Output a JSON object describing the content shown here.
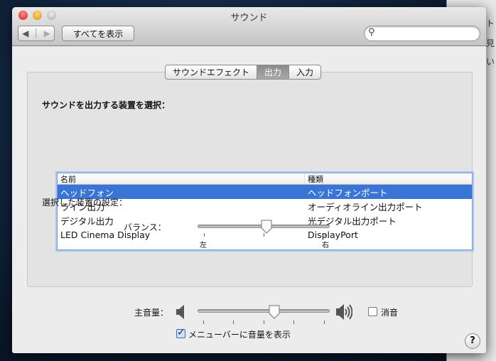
{
  "window": {
    "title": "サウンド",
    "show_all": "すべてを表示",
    "search_placeholder": ""
  },
  "tabs": [
    {
      "label": "サウンドエフェクト"
    },
    {
      "label": "出力",
      "selected": true
    },
    {
      "label": "入力"
    }
  ],
  "output": {
    "heading": "サウンドを出力する装置を選択：",
    "columns": [
      "名前",
      "種類"
    ],
    "rows": [
      {
        "name": "ヘッドフォン",
        "type": "ヘッドフォンポート",
        "selected": true
      },
      {
        "name": "ライン出力",
        "type": "オーディオライン出力ポート"
      },
      {
        "name": "デジタル出力",
        "type": "光デジタル出力ポート"
      },
      {
        "name": "LED Cinema Display",
        "type": "DisplayPort"
      }
    ],
    "settings_label": "選択した装置の設定：",
    "balance_label": "バランス：",
    "balance_left": "左",
    "balance_right": "右",
    "balance_value": 0.5,
    "help": "?"
  },
  "volume": {
    "label": "主音量：",
    "value": 0.56,
    "mute_label": "消音",
    "muted": false,
    "show_in_menubar_label": "メニューバーに音量を表示",
    "show_in_menubar": true
  },
  "background": {
    "partial_text": [
      "ト",
      "見",
      "い"
    ]
  },
  "colors": {
    "selection": "#3875d7"
  }
}
